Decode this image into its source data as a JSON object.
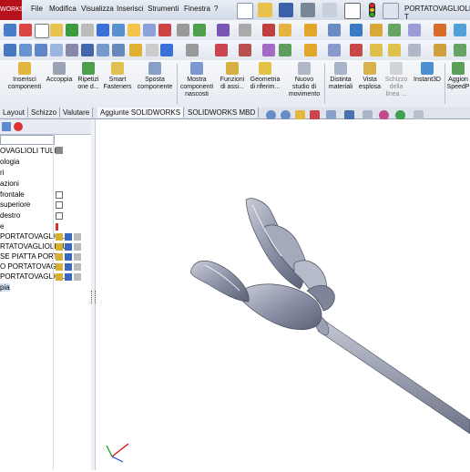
{
  "app": {
    "logo_text": "WORKS",
    "document_title": "PORTATOVAGLIOLI T"
  },
  "menu": [
    "File",
    "Modifica",
    "Visualizza",
    "Inserisci",
    "Strumenti",
    "Finestra",
    "?"
  ],
  "command_manager": [
    {
      "label": "Inserisci componenti",
      "icon": "insert-components-icon"
    },
    {
      "label": "Accoppia",
      "icon": "mate-icon"
    },
    {
      "label": "Ripetizi one d...",
      "icon": "pattern-icon"
    },
    {
      "label": "Smart Fasteners",
      "icon": "fastener-icon"
    },
    {
      "label": "Sposta componente",
      "icon": "move-component-icon"
    },
    {
      "label": "Mostra componenti nascosti",
      "icon": "show-hidden-icon"
    },
    {
      "label": "Funzioni di assi...",
      "icon": "assembly-features-icon"
    },
    {
      "label": "Geometria di riferim...",
      "icon": "reference-geometry-icon"
    },
    {
      "label": "Nuovo studio di movimento",
      "icon": "motion-study-icon"
    },
    {
      "label": "Distinta materiali",
      "icon": "bom-icon"
    },
    {
      "label": "Vista esplosa",
      "icon": "exploded-view-icon"
    },
    {
      "label": "Schizzo della linea ...",
      "icon": "explode-line-icon"
    },
    {
      "label": "Instant3D",
      "icon": "instant3d-icon"
    },
    {
      "label": "Aggion SpeedP",
      "icon": "speedpak-icon"
    }
  ],
  "tabs": [
    "Layout",
    "Schizzo",
    "Valutare",
    "Aggiunte SOLIDWORKS",
    "SOLIDWORKS MBD"
  ],
  "tree": [
    "OVAGLIOLI TULIP",
    "ologia",
    "ri",
    "azioni",
    "frontale",
    "superiore",
    "destro",
    "e",
    "PORTATOVAGLIOLI",
    "RTATOVAGLIOLI TU",
    "SE PIATTA PORTA",
    "O PORTATOVAG",
    "PORTATOVAGLIOLI",
    "pia"
  ],
  "colors": {
    "accent": "#b5121b",
    "part": "#8c93a8",
    "triad_x": "#d40000",
    "triad_y": "#00a000",
    "triad_z": "#1f3fd8"
  }
}
